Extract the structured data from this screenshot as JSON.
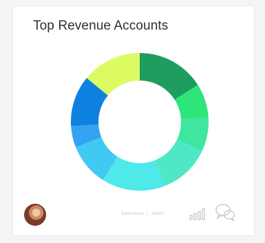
{
  "widget": {
    "title": "Top Revenue Accounts",
    "source": "Salesforce",
    "separator": "/",
    "updated": "15min"
  },
  "icons": {
    "avatar": "user-avatar",
    "bars": "bar-chart-icon",
    "chat": "chat-bubbles-icon"
  },
  "colors": {
    "card_bg": "#ffffff",
    "title_text": "#2b2f33",
    "muted": "#c6cbd1",
    "icon": "#c4c9cf"
  },
  "chart_data": {
    "type": "pie",
    "title": "Top Revenue Accounts",
    "donut": true,
    "legend": "none",
    "values": [
      {
        "value": 16,
        "color": "#1e9e5e"
      },
      {
        "value": 8,
        "color": "#2ee57a"
      },
      {
        "value": 8,
        "color": "#3fe6a0"
      },
      {
        "value": 12,
        "color": "#4ee8c6"
      },
      {
        "value": 15,
        "color": "#4ee9e8"
      },
      {
        "value": 10,
        "color": "#40c9f2"
      },
      {
        "value": 5,
        "color": "#34a2f0"
      },
      {
        "value": 12,
        "color": "#0e80e0"
      },
      {
        "value": 14,
        "color": "#dcfb62"
      }
    ]
  }
}
